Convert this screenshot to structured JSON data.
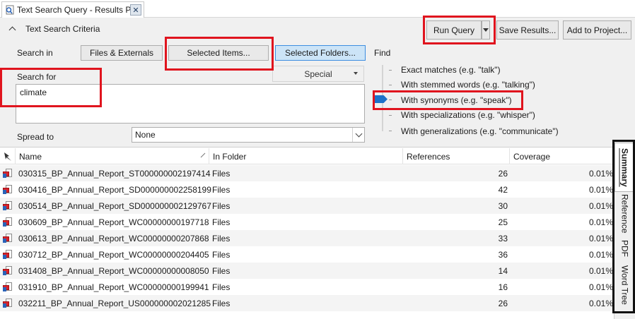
{
  "tab": {
    "title": "Text Search Query - Results Pre",
    "close_glyph": "✕"
  },
  "criteria": {
    "title": "Text Search Criteria",
    "buttons": {
      "run_query": "Run Query",
      "save_results": "Save Results...",
      "add_to_project": "Add to Project..."
    },
    "search_in": {
      "label": "Search in",
      "options": [
        "Files & Externals",
        "Selected Items...",
        "Selected Folders..."
      ],
      "selected": "Selected Folders..."
    },
    "special": "Special",
    "search_for": {
      "label": "Search for",
      "value": "climate"
    },
    "spread_to": {
      "label": "Spread to",
      "value": "None"
    },
    "find": {
      "label": "Find",
      "options": [
        "Exact matches (e.g. \"talk\")",
        "With stemmed words (e.g. \"talking\")",
        "With synonyms (e.g. \"speak\")",
        "With specializations (e.g. \"whisper\")",
        "With generalizations (e.g. \"communicate\")"
      ],
      "selected": "With synonyms (e.g. \"speak\")"
    }
  },
  "results": {
    "columns": [
      "Name",
      "In Folder",
      "References",
      "Coverage"
    ],
    "rows": [
      {
        "name": "030315_BP_Annual_Report_ST000000002197414",
        "folder": "Files",
        "references": "26",
        "coverage": "0.01%"
      },
      {
        "name": "030416_BP_Annual_Report_SD000000002258199",
        "folder": "Files",
        "references": "42",
        "coverage": "0.01%"
      },
      {
        "name": "030514_BP_Annual_Report_SD000000002129767",
        "folder": "Files",
        "references": "30",
        "coverage": "0.01%"
      },
      {
        "name": "030609_BP_Annual_Report_WC00000000197718",
        "folder": "Files",
        "references": "25",
        "coverage": "0.01%"
      },
      {
        "name": "030613_BP_Annual_Report_WC00000000207868",
        "folder": "Files",
        "references": "33",
        "coverage": "0.01%"
      },
      {
        "name": "030712_BP_Annual_Report_WC00000000204405",
        "folder": "Files",
        "references": "36",
        "coverage": "0.01%"
      },
      {
        "name": "031408_BP_Annual_Report_WC00000000008050",
        "folder": "Files",
        "references": "14",
        "coverage": "0.01%"
      },
      {
        "name": "031910_BP_Annual_Report_WC00000000199941",
        "folder": "Files",
        "references": "16",
        "coverage": "0.01%"
      },
      {
        "name": "032211_BP_Annual_Report_US000000002021285",
        "folder": "Files",
        "references": "26",
        "coverage": "0.01%"
      }
    ]
  },
  "side_tabs": {
    "items": [
      "Summary",
      "Reference",
      "PDF",
      "Word Tree"
    ],
    "active": "Summary"
  },
  "colors": {
    "highlight_red": "#e0141e",
    "selected_blue": "#cce4f7",
    "slider_blue": "#1e72c9",
    "pdf_red": "#d9232a"
  },
  "icons": [
    "tab-query-icon",
    "collapse-chevron-icon",
    "dropdown-arrow-icon",
    "slider-thumb-icon",
    "pin-icon",
    "sort-arrow-icon",
    "pdf-file-icon"
  ]
}
